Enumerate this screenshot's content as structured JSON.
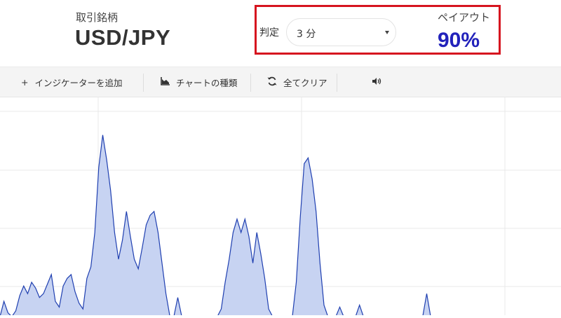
{
  "header": {
    "symbol_label": "取引銘柄",
    "symbol_value": "USD/JPY",
    "judgement_label": "判定",
    "duration_selected": "3 分",
    "payout_label": "ペイアウト",
    "payout_value": "90%",
    "highlight_color": "#d6141f",
    "payout_color": "#2222bb"
  },
  "toolbar": {
    "add_indicator": "インジケーターを追加",
    "chart_type": "チャートの種類",
    "clear_all": "全てクリア",
    "icons": [
      "plus-icon",
      "area-chart-icon",
      "refresh-icon",
      "speaker-icon"
    ]
  },
  "chart_data": {
    "type": "area",
    "fill_color": "#c7d3f2",
    "line_color": "#1f3fb0",
    "grid": true,
    "values": [
      0.0,
      0.08,
      0.02,
      0.0,
      0.03,
      0.11,
      0.16,
      0.12,
      0.18,
      0.15,
      0.1,
      0.12,
      0.17,
      0.22,
      0.08,
      0.05,
      0.16,
      0.2,
      0.22,
      0.13,
      0.07,
      0.04,
      0.2,
      0.26,
      0.44,
      0.78,
      0.95,
      0.82,
      0.66,
      0.44,
      0.3,
      0.4,
      0.55,
      0.42,
      0.3,
      0.25,
      0.36,
      0.48,
      0.53,
      0.55,
      0.44,
      0.28,
      0.12,
      0.0,
      0.0,
      0.1,
      0.0,
      0.0,
      0.0,
      0.0,
      0.0,
      0.0,
      0.0,
      0.0,
      0.0,
      0.0,
      0.04,
      0.18,
      0.3,
      0.44,
      0.51,
      0.44,
      0.51,
      0.42,
      0.28,
      0.44,
      0.33,
      0.2,
      0.04,
      0.0,
      0.0,
      0.0,
      0.0,
      0.0,
      0.0,
      0.18,
      0.52,
      0.8,
      0.83,
      0.72,
      0.55,
      0.28,
      0.06,
      0.0,
      0.0,
      0.0,
      0.05,
      0.0,
      0.0,
      0.0,
      0.0,
      0.06,
      0.0,
      0.0,
      0.0,
      0.0,
      0.0,
      0.0,
      0.0,
      0.0,
      0.0,
      0.0,
      0.0,
      0.0,
      0.0,
      0.0,
      0.0,
      0.0,
      0.12,
      0.0,
      0.0,
      0.0,
      0.0,
      0.0,
      0.0,
      0.0,
      0.0,
      0.0,
      0.0,
      0.0,
      0.0,
      0.0,
      0.0,
      0.0,
      0.0,
      0.0,
      0.0,
      0.0,
      0.0,
      0.0,
      0.0,
      0.0,
      0.0,
      0.0,
      0.0,
      0.0,
      0.0,
      0.0,
      0.0,
      0.0,
      0.0,
      0.0,
      0.0
    ]
  }
}
